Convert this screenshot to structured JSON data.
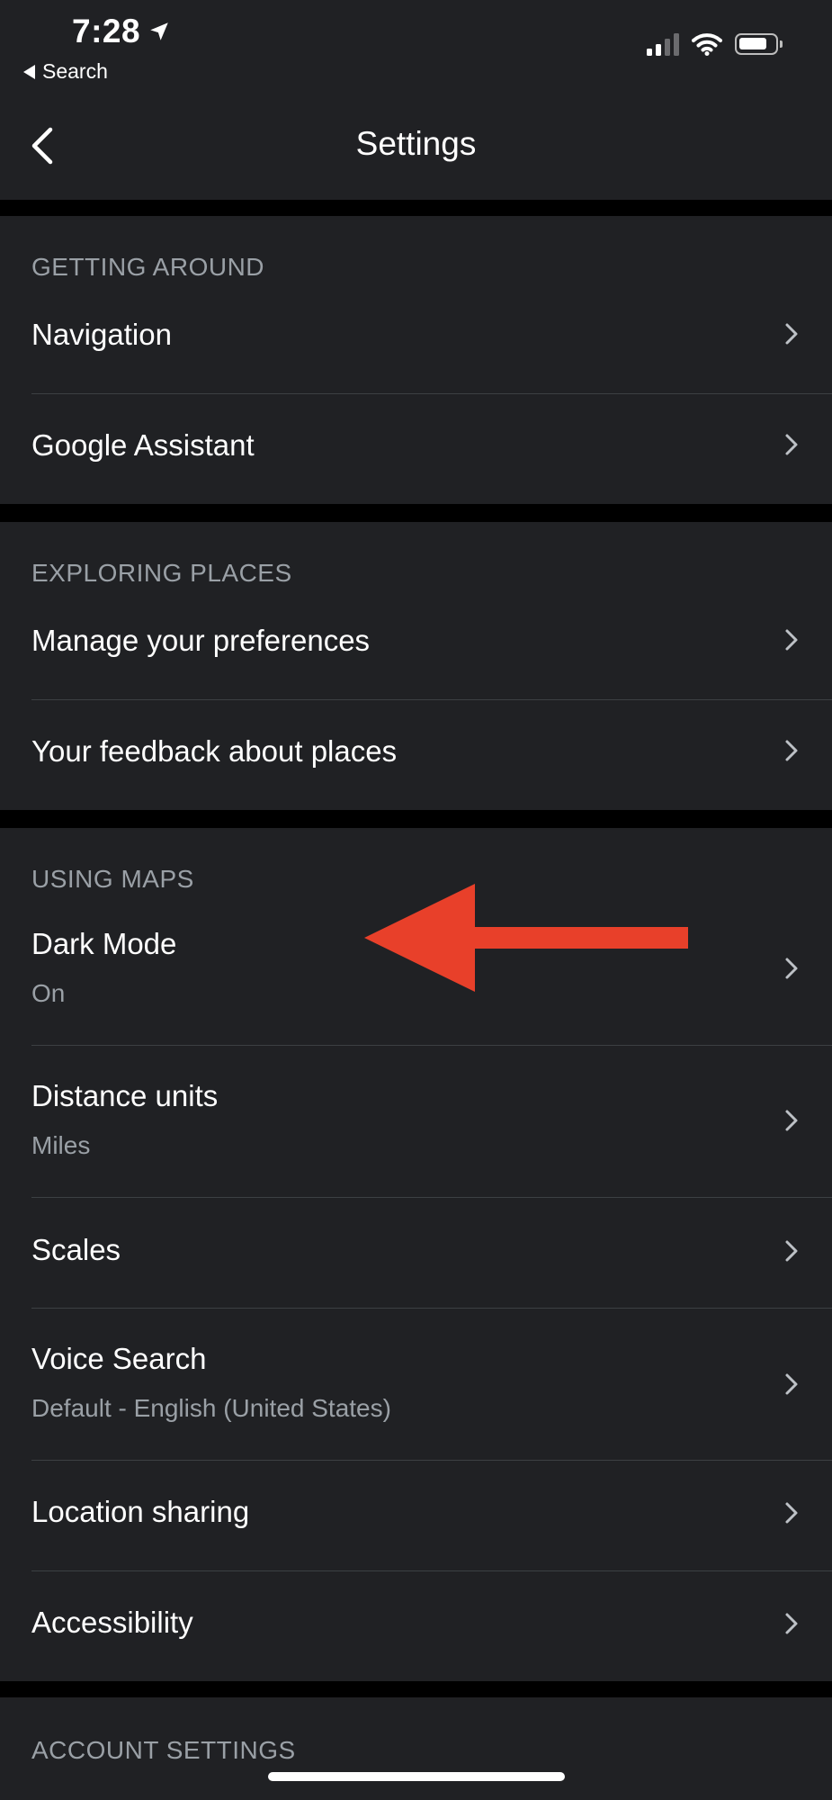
{
  "status_bar": {
    "time": "7:28",
    "back_app_label": "Search"
  },
  "nav": {
    "title": "Settings"
  },
  "sections": {
    "getting_around": {
      "header": "GETTING AROUND",
      "items": [
        {
          "label": "Navigation"
        },
        {
          "label": "Google Assistant"
        }
      ]
    },
    "exploring_places": {
      "header": "EXPLORING PLACES",
      "items": [
        {
          "label": "Manage your preferences"
        },
        {
          "label": "Your feedback about places"
        }
      ]
    },
    "using_maps": {
      "header": "USING MAPS",
      "items": [
        {
          "label": "Dark Mode",
          "value": "On"
        },
        {
          "label": "Distance units",
          "value": "Miles"
        },
        {
          "label": "Scales"
        },
        {
          "label": "Voice Search",
          "value": "Default - English (United States)"
        },
        {
          "label": "Location sharing"
        },
        {
          "label": "Accessibility"
        }
      ]
    },
    "account_settings": {
      "header": "ACCOUNT SETTINGS"
    }
  },
  "colors": {
    "background": "#202124",
    "separator": "#000000",
    "secondary_text": "#9aa0a6",
    "annotation_arrow": "#e8402a"
  }
}
